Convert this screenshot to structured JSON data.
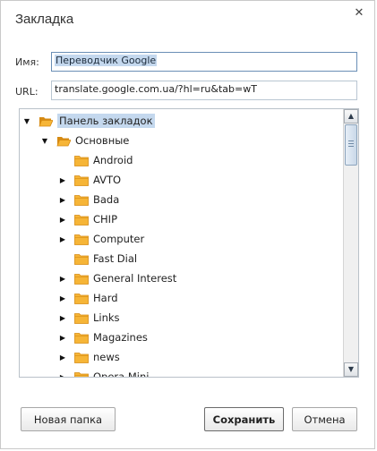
{
  "dialog": {
    "title": "Закладка",
    "close_glyph": "✕"
  },
  "form": {
    "name_label": "Имя:",
    "name_value": "Переводчик Google",
    "url_label": "URL:",
    "url_value": "translate.google.com.ua/?hl=ru&tab=wT"
  },
  "tree": {
    "items": [
      {
        "label": "Панель закладок",
        "depth": 0,
        "expanded": true,
        "has_children": true,
        "selected": true
      },
      {
        "label": "Основные",
        "depth": 1,
        "expanded": true,
        "has_children": true
      },
      {
        "label": "Android",
        "depth": 2,
        "has_children": false
      },
      {
        "label": "AVTO",
        "depth": 2,
        "has_children": true
      },
      {
        "label": "Bada",
        "depth": 2,
        "has_children": true
      },
      {
        "label": "CHIP",
        "depth": 2,
        "has_children": true
      },
      {
        "label": "Computer",
        "depth": 2,
        "has_children": true
      },
      {
        "label": "Fast Dial",
        "depth": 2,
        "has_children": false
      },
      {
        "label": "General Interest",
        "depth": 2,
        "has_children": true
      },
      {
        "label": "Hard",
        "depth": 2,
        "has_children": true
      },
      {
        "label": "Links",
        "depth": 2,
        "has_children": true
      },
      {
        "label": "Magazines",
        "depth": 2,
        "has_children": true
      },
      {
        "label": "news",
        "depth": 2,
        "has_children": true
      },
      {
        "label": "Opera Mini",
        "depth": 2,
        "has_children": true
      }
    ],
    "scroll_position": 0.0
  },
  "buttons": {
    "new_folder": "Новая папка",
    "save": "Сохранить",
    "cancel": "Отмена"
  },
  "colors": {
    "selection": "#c4d8ee",
    "folder": "#f6b537",
    "folder_dark": "#d68a12"
  }
}
